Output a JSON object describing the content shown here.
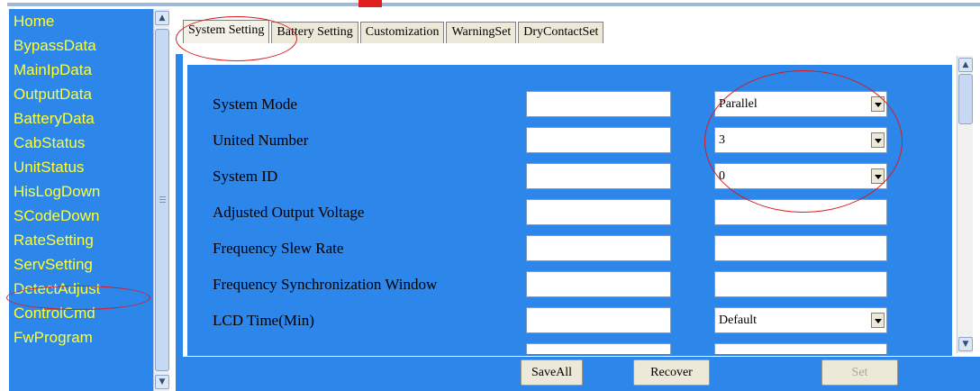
{
  "nav": {
    "items": [
      "Home",
      "BypassData",
      "MainIpData",
      "OutputData",
      "BatteryData",
      "CabStatus",
      "UnitStatus",
      "HisLogDown",
      "SCodeDown",
      "RateSetting",
      "ServSetting",
      "DetectAdjust",
      "ControlCmd",
      "FwProgram"
    ],
    "highlighted": "ServSetting"
  },
  "tabs": [
    "System Setting",
    "Battery Setting",
    "Customization",
    "WarningSet",
    "DryContactSet"
  ],
  "active_tab": "System Setting",
  "form": {
    "rows": [
      {
        "label": "System Mode",
        "input_value": "",
        "control": "select",
        "select_value": "Parallel"
      },
      {
        "label": "United Number",
        "input_value": "",
        "control": "select",
        "select_value": "3"
      },
      {
        "label": "System ID",
        "input_value": "",
        "control": "select",
        "select_value": "0"
      },
      {
        "label": "Adjusted Output Voltage",
        "input_value": "",
        "control": "text",
        "text_value": ""
      },
      {
        "label": "Frequency Slew Rate",
        "input_value": "",
        "control": "text",
        "text_value": ""
      },
      {
        "label": "Frequency Synchronization Window",
        "input_value": "",
        "control": "text",
        "text_value": ""
      },
      {
        "label": "LCD Time(Min)",
        "input_value": "",
        "control": "select",
        "select_value": "Default"
      }
    ]
  },
  "buttons": {
    "save_all": "SaveAll",
    "recover": "Recover",
    "set": "Set"
  },
  "colors": {
    "panel_blue": "#2d86e9",
    "nav_text": "#ffff33",
    "annotation_red": "#d81b1b"
  }
}
